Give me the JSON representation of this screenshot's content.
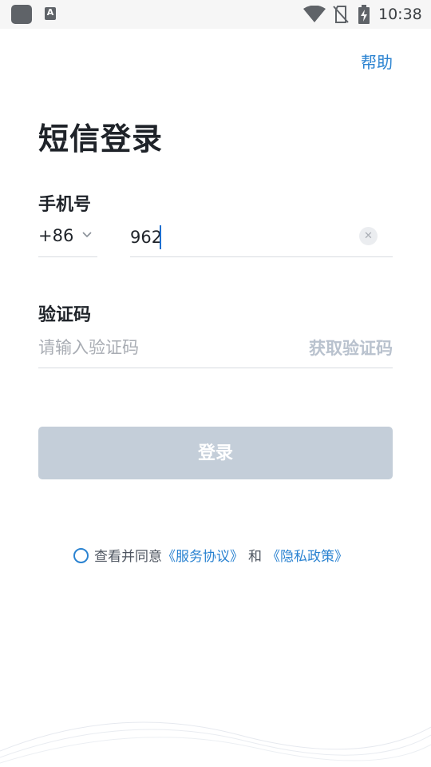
{
  "status_bar": {
    "time": "10:38",
    "icons": [
      "app-icon",
      "keyboard-icon",
      "wifi-icon",
      "no-sim-icon",
      "battery-charging-icon"
    ],
    "keyboard_letter": "A"
  },
  "header": {
    "help": "帮助"
  },
  "title": "短信登录",
  "phone": {
    "label": "手机号",
    "country_code": "+86",
    "value": "962",
    "clear_icon": "close-icon"
  },
  "code": {
    "label": "验证码",
    "placeholder": "请输入验证码",
    "get_code": "获取验证码"
  },
  "login_button": "登录",
  "agreement": {
    "text": "查看并同意",
    "terms": "《服务协议》",
    "and": "和",
    "privacy": "《隐私政策》"
  },
  "colors": {
    "accent": "#2b83d1",
    "button_disabled": "#c4ced9",
    "placeholder": "#a9adb4"
  }
}
